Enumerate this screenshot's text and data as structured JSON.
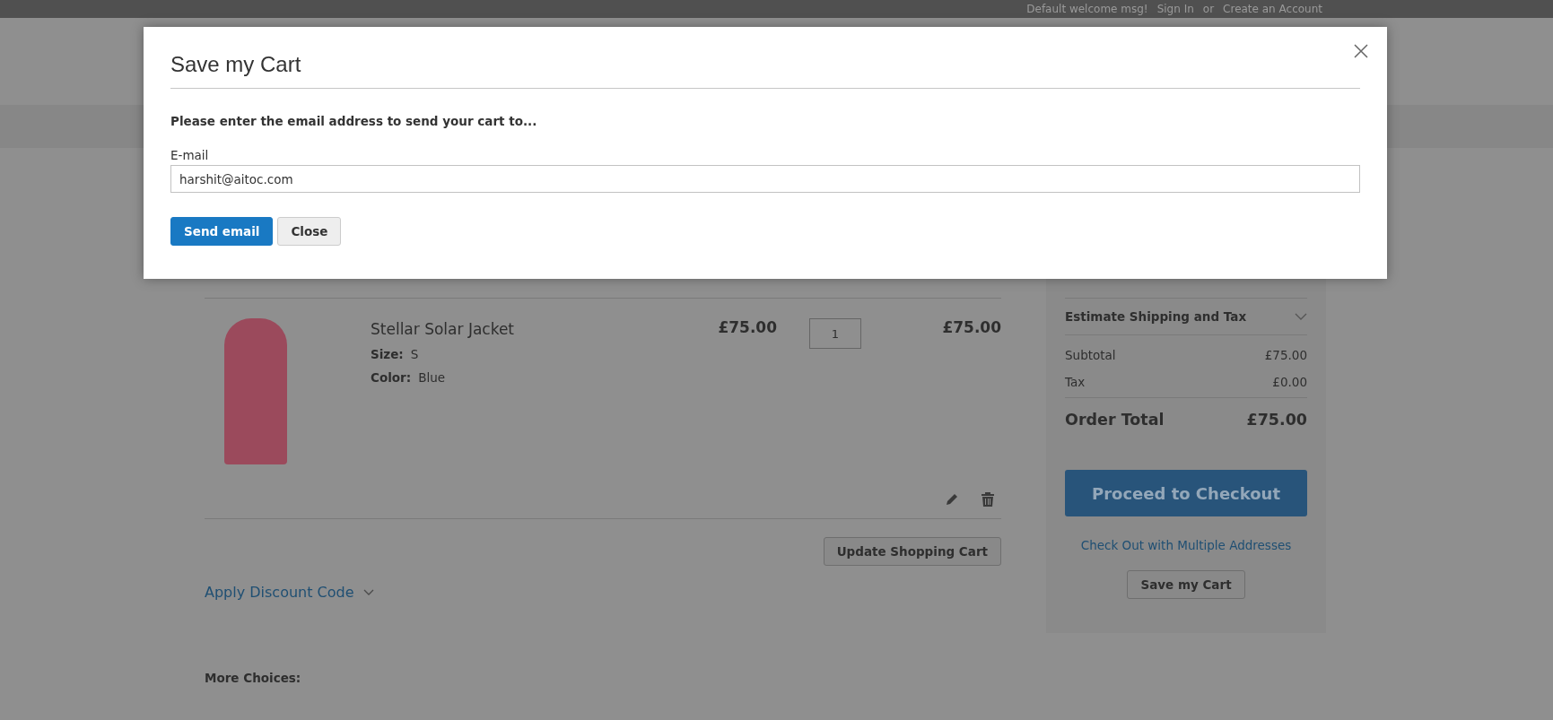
{
  "top_bar": {
    "links": [
      {
        "text": "Default welcome msg!"
      },
      {
        "text": "Sign In"
      },
      {
        "text": "or"
      },
      {
        "text": "Create an Account"
      }
    ]
  },
  "cart": {
    "items": [
      {
        "name": "Stellar Solar Jacket",
        "price": "£75.00",
        "qty": "1",
        "subtotal": "£75.00",
        "options": [
          {
            "label": "Size:",
            "value": "S"
          },
          {
            "label": "Color:",
            "value": "Blue"
          }
        ]
      }
    ],
    "update_button": "Update Shopping Cart",
    "discount_link": "Apply Discount Code",
    "more_choices": "More Choices:"
  },
  "summary": {
    "estimate": "Estimate Shipping and Tax",
    "expanded": false,
    "totals": [
      {
        "label": "Subtotal",
        "value": "£75.00",
        "kind": "line"
      },
      {
        "label": "Tax",
        "value": "£0.00",
        "kind": "line"
      },
      {
        "label": "Order Total",
        "value": "£75.00",
        "kind": "grand"
      }
    ],
    "checkout_button": "Proceed to Checkout",
    "multi_address_link": "Check Out with Multiple Addresses",
    "save_cart_button": "Save my Cart"
  },
  "modal": {
    "title": "Save my Cart",
    "instruction": "Please enter the email address to send your cart to...",
    "field": {
      "label": "E-mail",
      "value": "harshit@aitoc.com"
    },
    "buttons": [
      {
        "label": "Send email",
        "kind": "primary"
      },
      {
        "label": "Close",
        "kind": "secondary"
      }
    ]
  }
}
